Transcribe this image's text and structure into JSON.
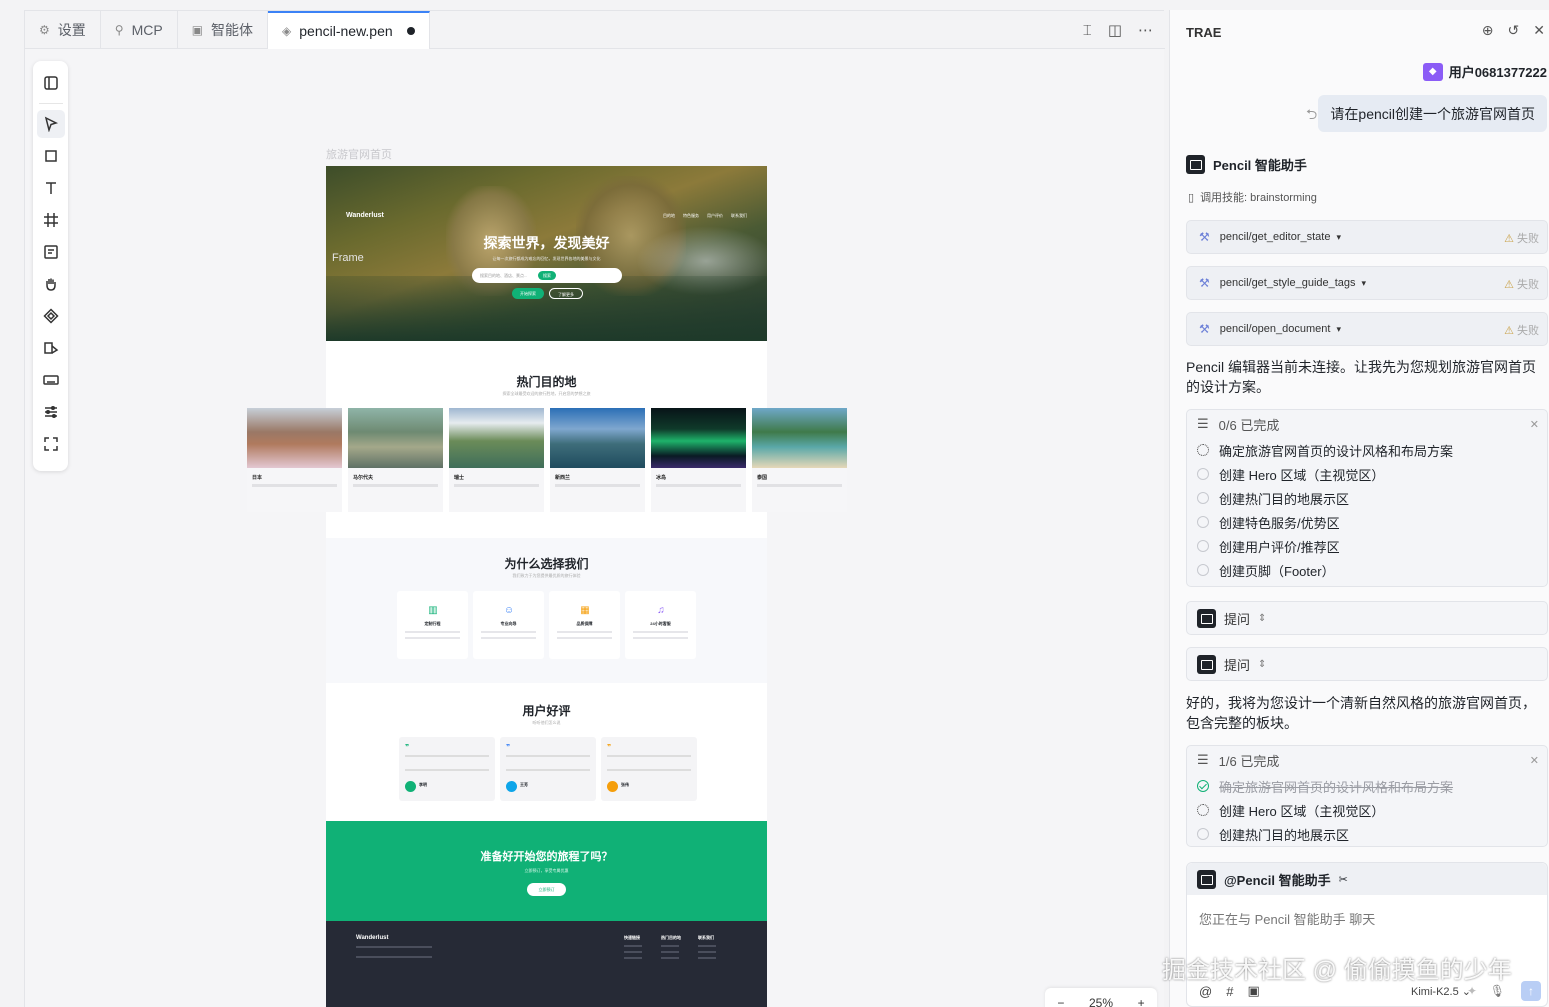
{
  "editor": {
    "tabs": [
      {
        "icon": "gear-icon",
        "label": "设置"
      },
      {
        "icon": "plug-icon",
        "label": "MCP"
      },
      {
        "icon": "agent-icon",
        "label": "智能体"
      },
      {
        "icon": "shield-icon",
        "label": "pencil-new.pen",
        "unsaved": true
      }
    ],
    "canvas_label": "旅游官网首页",
    "zoom": "25%"
  },
  "design": {
    "frame_tag": "Frame",
    "hero": {
      "brand": "Wanderlust",
      "nav": [
        "目的地",
        "特色服务",
        "用户评价",
        "联系我们"
      ],
      "title": "探索世界，发现美好",
      "subtitle": "让每一次旅行都成为难忘的回忆，发现世界各地的美景与文化",
      "search_placeholder": "搜索目的地、酒店、景点...",
      "search_button": "搜索",
      "primary_button": "开始探索",
      "secondary_button": "了解更多"
    },
    "destinations": {
      "title": "热门目的地",
      "subtitle": "探索全球最受欢迎的旅行胜地，开启您的梦想之旅",
      "items": [
        {
          "name": "日本"
        },
        {
          "name": "马尔代夫"
        },
        {
          "name": "瑞士"
        },
        {
          "name": "新西兰"
        },
        {
          "name": "冰岛"
        },
        {
          "name": "泰国"
        }
      ]
    },
    "why": {
      "title": "为什么选择我们",
      "subtitle": "我们致力于为您提供最优质的旅行体验",
      "cards": [
        {
          "title": "定制行程"
        },
        {
          "title": "专业向导"
        },
        {
          "title": "品质保障"
        },
        {
          "title": "24小时客服"
        }
      ]
    },
    "reviews": {
      "title": "用户好评",
      "subtitle": "听听他们怎么说",
      "items": [
        {
          "name": "李明"
        },
        {
          "name": "王芳"
        },
        {
          "name": "张伟"
        }
      ]
    },
    "cta": {
      "title": "准备好开始您的旅程了吗？",
      "subtitle": "立即预订，享受专属优惠",
      "button": "立即预订"
    },
    "footer": {
      "brand": "Wanderlust",
      "columns": [
        "快速链接",
        "热门目的地",
        "联系我们"
      ]
    }
  },
  "panel": {
    "title": "TRAE",
    "user_name": "用户0681377222",
    "user_message": "请在pencil创建一个旅游官网首页",
    "bot_name": "Pencil 智能助手",
    "skill": "调用技能: brainstorming",
    "tool_calls": [
      {
        "name": "pencil/get_editor_state",
        "status": "失败"
      },
      {
        "name": "pencil/get_style_guide_tags",
        "status": "失败"
      },
      {
        "name": "pencil/open_document",
        "status": "失败"
      }
    ],
    "message1": "Pencil 编辑器当前未连接。让我先为您规划旅游官网首页的设计方案。",
    "todo1": {
      "header": "0/6 已完成",
      "items": [
        "确定旅游官网首页的设计风格和布局方案",
        "创建 Hero 区域（主视觉区）",
        "创建热门目的地展示区",
        "创建特色服务/优势区",
        "创建用户评价/推荐区",
        "创建页脚（Footer）"
      ]
    },
    "ask_label": "提问",
    "message2": "好的，我将为您设计一个清新自然风格的旅游官网首页，包含完整的板块。",
    "todo2": {
      "header": "1/6 已完成",
      "items": [
        "确定旅游官网首页的设计风格和布局方案",
        "创建 Hero 区域（主视觉区）",
        "创建热门目的地展示区"
      ]
    },
    "composer": {
      "mention": "@Pencil 智能助手",
      "placeholder": "您正在与 Pencil 智能助手 聊天",
      "model": "Kimi-K2.5"
    }
  },
  "watermark": "掘金技术社区 @ 偷偷摸鱼的少年",
  "colors": {
    "accent_green": "#10b176",
    "footer_dark": "#262a36",
    "fail_yellow": "#c9a24a",
    "tab_active": "#3b82f6"
  }
}
